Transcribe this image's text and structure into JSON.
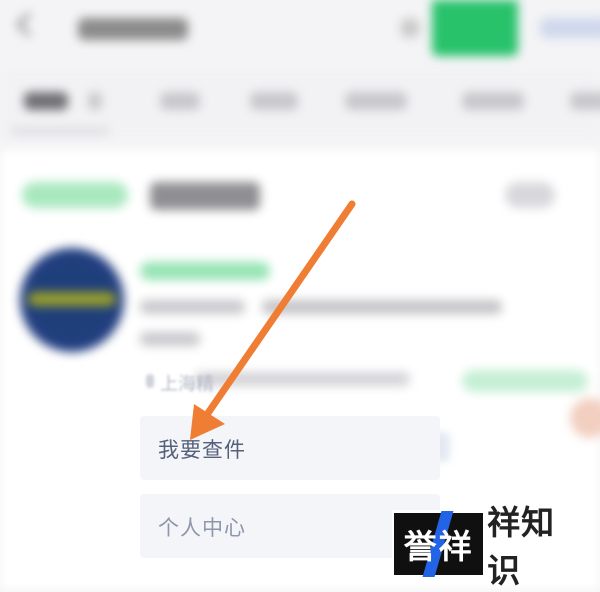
{
  "menu": {
    "items": [
      {
        "label": "我要查件"
      },
      {
        "label": "个人中心"
      }
    ]
  },
  "location_text": "上海精",
  "watermark": {
    "left_text": "誉祥",
    "right_text": "祥知识",
    "accent_color": "#2364e6"
  },
  "arrow": {
    "color": "#f07d34",
    "icon": "arrow-pointer-icon"
  },
  "colors": {
    "brand_green": "#27c26a",
    "menu_bg": "#f4f5f8"
  }
}
